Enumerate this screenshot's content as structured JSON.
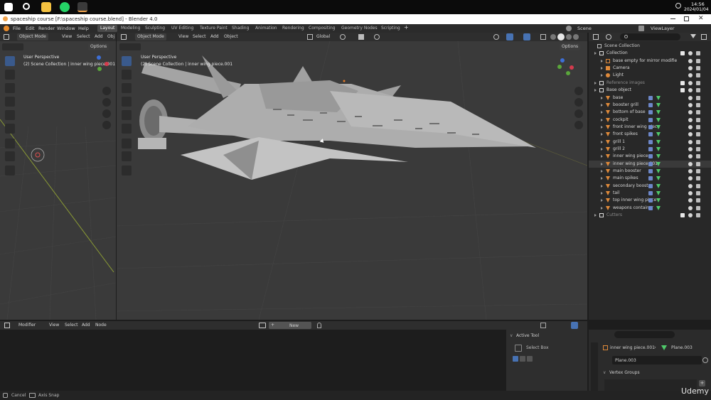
{
  "taskbar": {
    "time": "14:56",
    "date": "2024/01/04"
  },
  "titlebar": {
    "title": "spaceship course [F:\\spaceship course.blend] - Blender 4.0"
  },
  "menu": [
    "File",
    "Edit",
    "Render",
    "Window",
    "Help"
  ],
  "workspaces": [
    "Layout",
    "Modeling",
    "Sculpting",
    "UV Editing",
    "Texture Paint",
    "Shading",
    "Animation",
    "Rendering",
    "Compositing",
    "Geometry Nodes",
    "Scripting"
  ],
  "active_workspace": "Layout",
  "scene": "Scene",
  "view_layer": "ViewLayer",
  "left_viewport": {
    "mode": "Object Mode",
    "menus": [
      "View",
      "Select",
      "Add",
      "Obj"
    ],
    "options": "Options",
    "overlay_title": "User Perspective",
    "overlay_sub": "(2) Scene Collection | inner wing piece.001"
  },
  "main_viewport": {
    "mode": "Object Mode",
    "menus": [
      "View",
      "Select",
      "Add",
      "Object"
    ],
    "transform": "Global",
    "options": "Options",
    "overlay_title": "User Perspective",
    "overlay_sub": "(2) Scene Collection | inner wing piece.001"
  },
  "outliner": {
    "root": "Scene Collection",
    "items": [
      {
        "label": "Collection",
        "indent": 1,
        "kind": "collection"
      },
      {
        "label": "base empty for mirror modifie",
        "indent": 2,
        "kind": "empty"
      },
      {
        "label": "Camera",
        "indent": 2,
        "kind": "camera"
      },
      {
        "label": "Light",
        "indent": 2,
        "kind": "light"
      },
      {
        "label": "Reference images",
        "indent": 1,
        "kind": "collection-dim"
      },
      {
        "label": "Base object",
        "indent": 1,
        "kind": "collection"
      },
      {
        "label": "base",
        "indent": 2,
        "kind": "mesh"
      },
      {
        "label": "booster grill",
        "indent": 2,
        "kind": "mesh"
      },
      {
        "label": "bottom of base",
        "indent": 2,
        "kind": "mesh"
      },
      {
        "label": "cockpit",
        "indent": 2,
        "kind": "mesh"
      },
      {
        "label": "front inner wing piece",
        "indent": 2,
        "kind": "mesh"
      },
      {
        "label": "front spikes",
        "indent": 2,
        "kind": "mesh"
      },
      {
        "label": "grill 1",
        "indent": 2,
        "kind": "mesh"
      },
      {
        "label": "grill 2",
        "indent": 2,
        "kind": "mesh"
      },
      {
        "label": "inner wing piece",
        "indent": 2,
        "kind": "mesh"
      },
      {
        "label": "inner wing piece.001",
        "indent": 2,
        "kind": "mesh-active"
      },
      {
        "label": "main booster",
        "indent": 2,
        "kind": "mesh"
      },
      {
        "label": "main spikes",
        "indent": 2,
        "kind": "mesh"
      },
      {
        "label": "secondary booster",
        "indent": 2,
        "kind": "mesh"
      },
      {
        "label": "tail",
        "indent": 2,
        "kind": "mesh"
      },
      {
        "label": "top inner wing piece",
        "indent": 2,
        "kind": "mesh"
      },
      {
        "label": "weapons container",
        "indent": 2,
        "kind": "mesh"
      },
      {
        "label": "Cutters",
        "indent": 1,
        "kind": "collection-dim"
      }
    ]
  },
  "node_editor": {
    "type": "Modifier",
    "menus": [
      "View",
      "Select",
      "Add",
      "Node"
    ],
    "new_label": "New"
  },
  "active_tool": {
    "header": "Active Tool",
    "tool": "Select Box"
  },
  "properties": {
    "object": "inner wing piece.001",
    "mesh": "Plane.003",
    "data_name": "Plane.003",
    "section": "Vertex Groups"
  },
  "status": {
    "cancel": "Cancel",
    "axis_snap": "Axis Snap",
    "watermark": "Udemy"
  },
  "colors": {
    "accent": "#4772b3",
    "viewport_bg": "#3a3a3a",
    "mesh": "#a7a7a7",
    "mesh_icon": "#e08a3a",
    "vertex_group": "#4fc96a"
  }
}
